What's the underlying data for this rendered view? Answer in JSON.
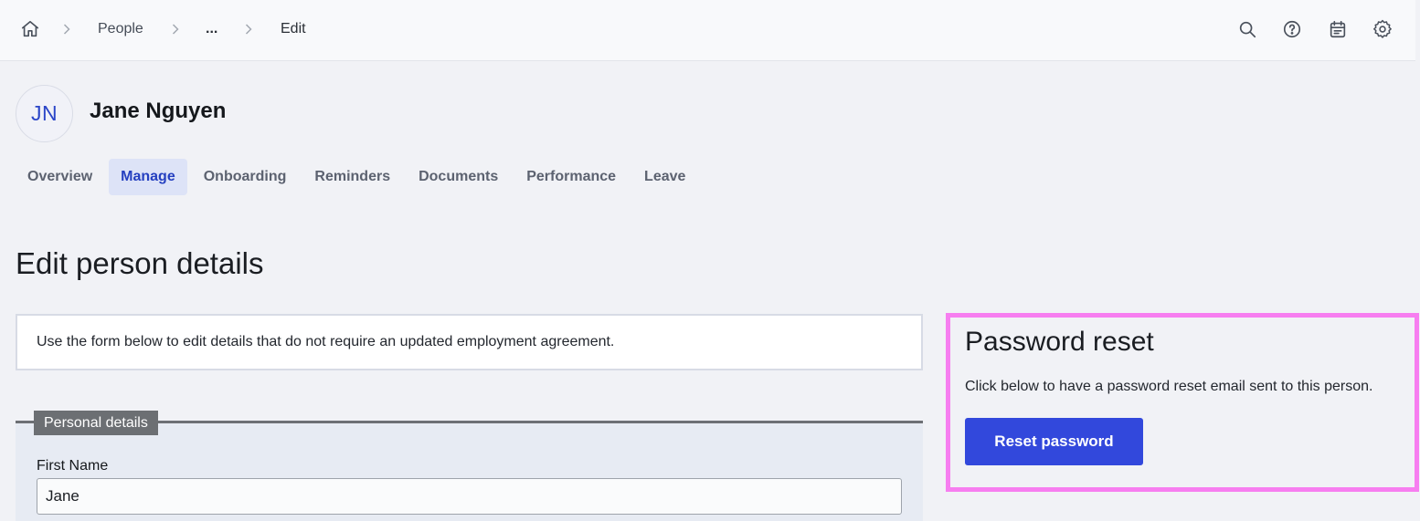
{
  "breadcrumb": {
    "home_icon": "home-icon",
    "items": [
      {
        "label": "People"
      },
      {
        "label": "..."
      },
      {
        "label": "Edit"
      }
    ]
  },
  "toolbar": {
    "icons": [
      "search-icon",
      "help-icon",
      "calendar-icon",
      "settings-icon"
    ]
  },
  "person": {
    "initials": "JN",
    "name": "Jane Nguyen"
  },
  "tabs": [
    {
      "label": "Overview",
      "active": false
    },
    {
      "label": "Manage",
      "active": true
    },
    {
      "label": "Onboarding",
      "active": false
    },
    {
      "label": "Reminders",
      "active": false
    },
    {
      "label": "Documents",
      "active": false
    },
    {
      "label": "Performance",
      "active": false
    },
    {
      "label": "Leave",
      "active": false
    }
  ],
  "page": {
    "title": "Edit person details",
    "info_text": "Use the form below to edit details that do not require an updated employment agreement."
  },
  "personal_details": {
    "legend": "Personal details",
    "first_name_label": "First Name",
    "first_name_value": "Jane"
  },
  "password_reset": {
    "title": "Password reset",
    "description": "Click below to have a password reset email sent to this person.",
    "button_label": "Reset password"
  },
  "colors": {
    "accent": "#3248dc",
    "active_tab_bg": "#dde3f7",
    "highlight_border": "#f77ef0"
  }
}
